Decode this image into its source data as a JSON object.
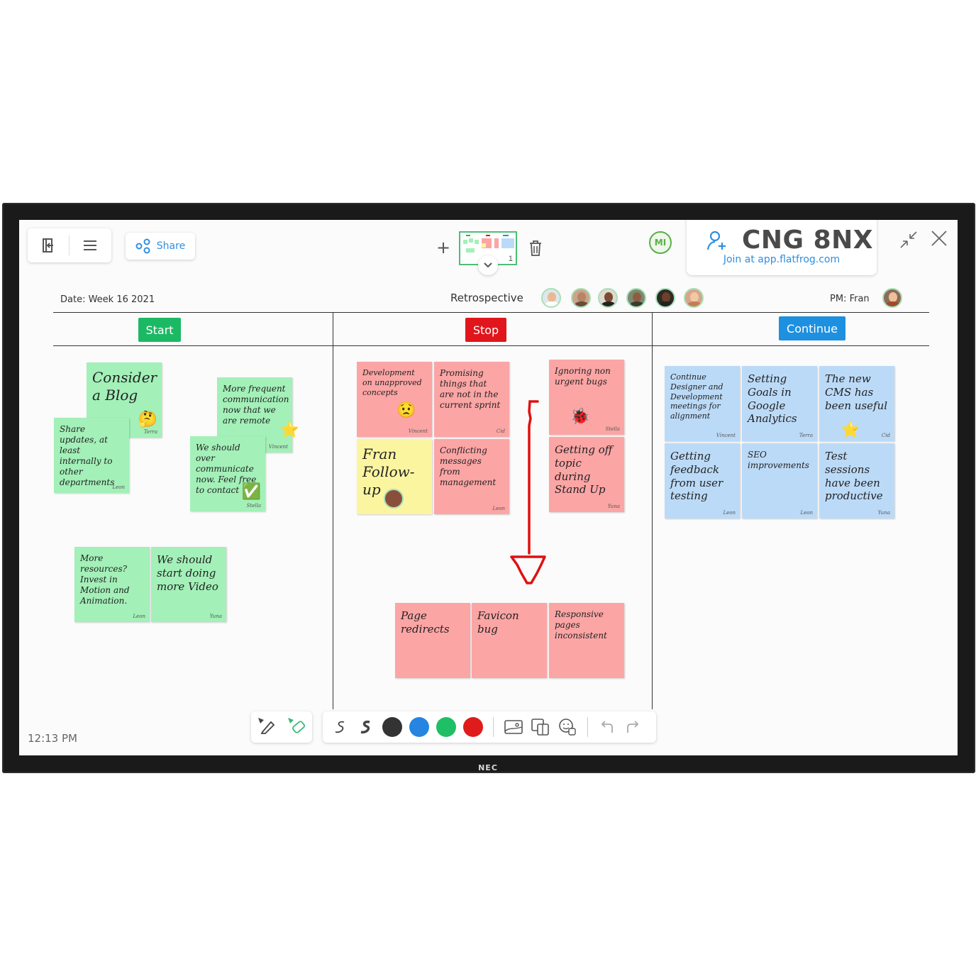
{
  "device": {
    "brand": "NEC"
  },
  "toolbar": {
    "share_label": "Share",
    "exit_icon": "exit-board-icon",
    "menu_icon": "hamburger-menu-icon",
    "add_page_label": "+",
    "page_number": "1",
    "delete_icon": "trash-icon",
    "user_initials": "MI"
  },
  "join": {
    "code": "CNG 8NX",
    "url_text": "Join at app.flatfrog.com",
    "icon": "add-user-icon"
  },
  "board": {
    "date": "Date: Week 16 2021",
    "title": "Retrospective",
    "pm": "PM: Fran",
    "columns": [
      {
        "label": "Start",
        "color": "#1cb964"
      },
      {
        "label": "Stop",
        "color": "#e0161c"
      },
      {
        "label": "Continue",
        "color": "#1e90e0"
      }
    ],
    "start_notes": [
      {
        "text": "Consider a Blog",
        "author": "Terra",
        "emoji": "🤔"
      },
      {
        "text": "Share updates, at least internally to other departments",
        "author": "Leon"
      },
      {
        "text": "More frequent communication now that we are remote",
        "author": "Vincent",
        "emoji": "⭐"
      },
      {
        "text": "We should over communicate now. Feel free to contact",
        "author": "Stella",
        "emoji": "✅"
      },
      {
        "text": "More resources? Invest in Motion and Animation.",
        "author": "Leon"
      },
      {
        "text": "We should start doing more Video",
        "author": "Yuna"
      }
    ],
    "stop_notes": [
      {
        "text": "Development on unapproved concepts",
        "author": "Vincent",
        "emoji": "😟"
      },
      {
        "text": "Promising things that are not in the current sprint",
        "author": "Cid"
      },
      {
        "text": "Ignoring non urgent bugs",
        "author": "Stella",
        "emoji": "🐞"
      },
      {
        "text": "Fran Follow-up",
        "author": ""
      },
      {
        "text": "Conflicting messages from management",
        "author": "Leon"
      },
      {
        "text": "Getting off topic during Stand Up",
        "author": "Yuna"
      },
      {
        "text": "Page redirects",
        "author": ""
      },
      {
        "text": "Favicon bug",
        "author": ""
      },
      {
        "text": "Responsive pages inconsistent",
        "author": ""
      }
    ],
    "continue_notes": [
      {
        "text": "Continue Designer and Development meetings for alignment",
        "author": "Vincent"
      },
      {
        "text": "Setting Goals in Google Analytics",
        "author": "Terra"
      },
      {
        "text": "The new CMS has been useful",
        "author": "Cid",
        "emoji": "⭐"
      },
      {
        "text": "Getting feedback from user testing",
        "author": "Leon"
      },
      {
        "text": "SEO improvements",
        "author": "Leon"
      },
      {
        "text": "Test sessions have been productive",
        "author": "Yuna"
      }
    ]
  },
  "drawing_tools": {
    "pen_label": "pen-icon",
    "eraser_label": "eraser-icon",
    "colors": [
      "#333333",
      "#2585e0",
      "#1fbf66",
      "#e01b1b"
    ],
    "undo": "undo-icon",
    "redo": "redo-icon"
  },
  "status": {
    "time": "12:13 PM"
  }
}
